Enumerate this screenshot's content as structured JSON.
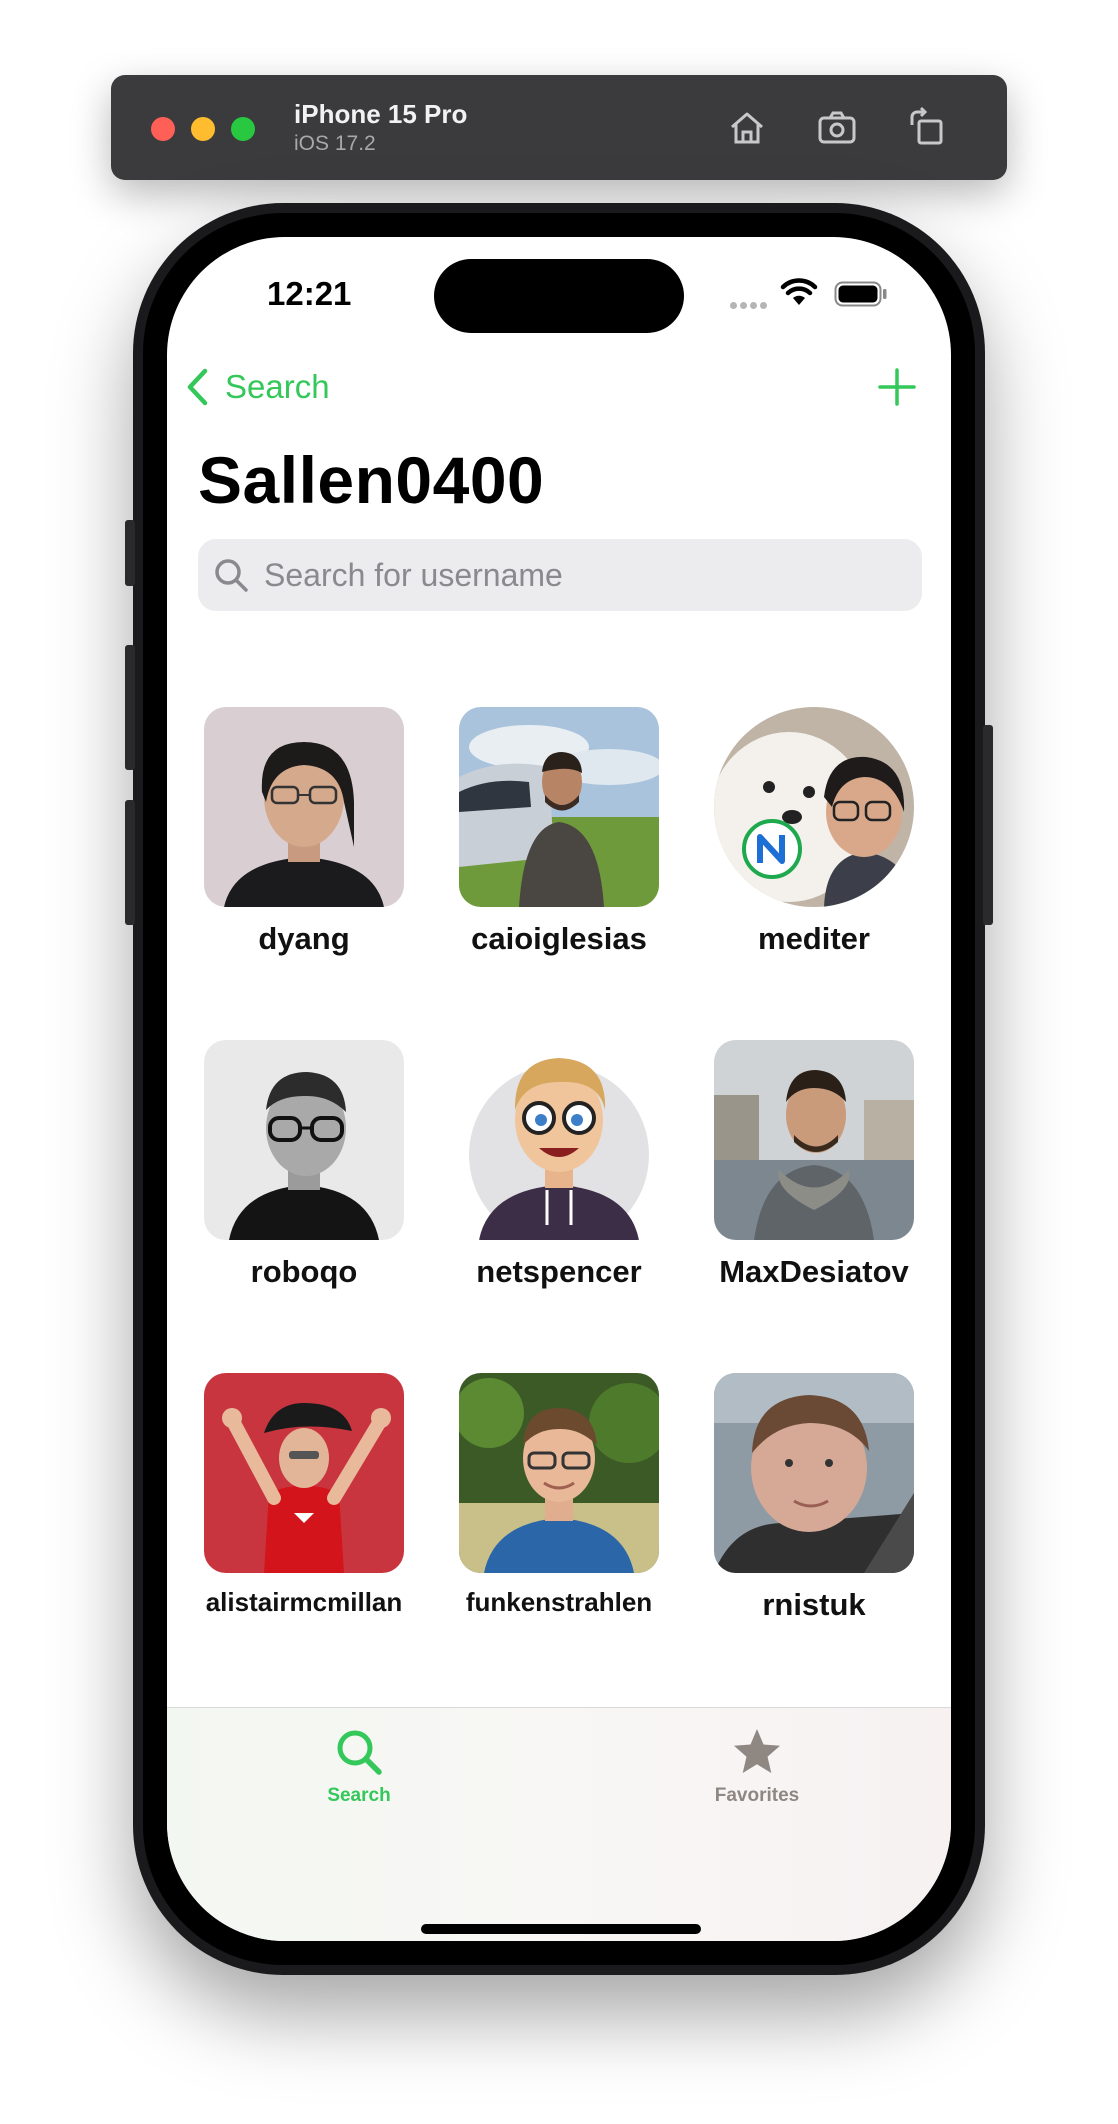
{
  "simulator": {
    "device": "iPhone 15 Pro",
    "os": "iOS 17.2"
  },
  "status_bar": {
    "time": "12:21"
  },
  "nav": {
    "back_label": "Search"
  },
  "page": {
    "title": "Sallen0400"
  },
  "search": {
    "placeholder": "Search for username",
    "value": ""
  },
  "users": [
    {
      "username": "dyang"
    },
    {
      "username": "caioiglesias"
    },
    {
      "username": "mediter"
    },
    {
      "username": "roboqo"
    },
    {
      "username": "netspencer"
    },
    {
      "username": "MaxDesiatov"
    },
    {
      "username": "alistairmcmillan"
    },
    {
      "username": "funkenstrahlen"
    },
    {
      "username": "rnistuk"
    }
  ],
  "tabs": [
    {
      "label": "Search",
      "active": true,
      "icon": "search-icon"
    },
    {
      "label": "Favorites",
      "active": false,
      "icon": "star-icon"
    }
  ],
  "colors": {
    "accent": "#34c759",
    "inactive": "#8e8782"
  }
}
